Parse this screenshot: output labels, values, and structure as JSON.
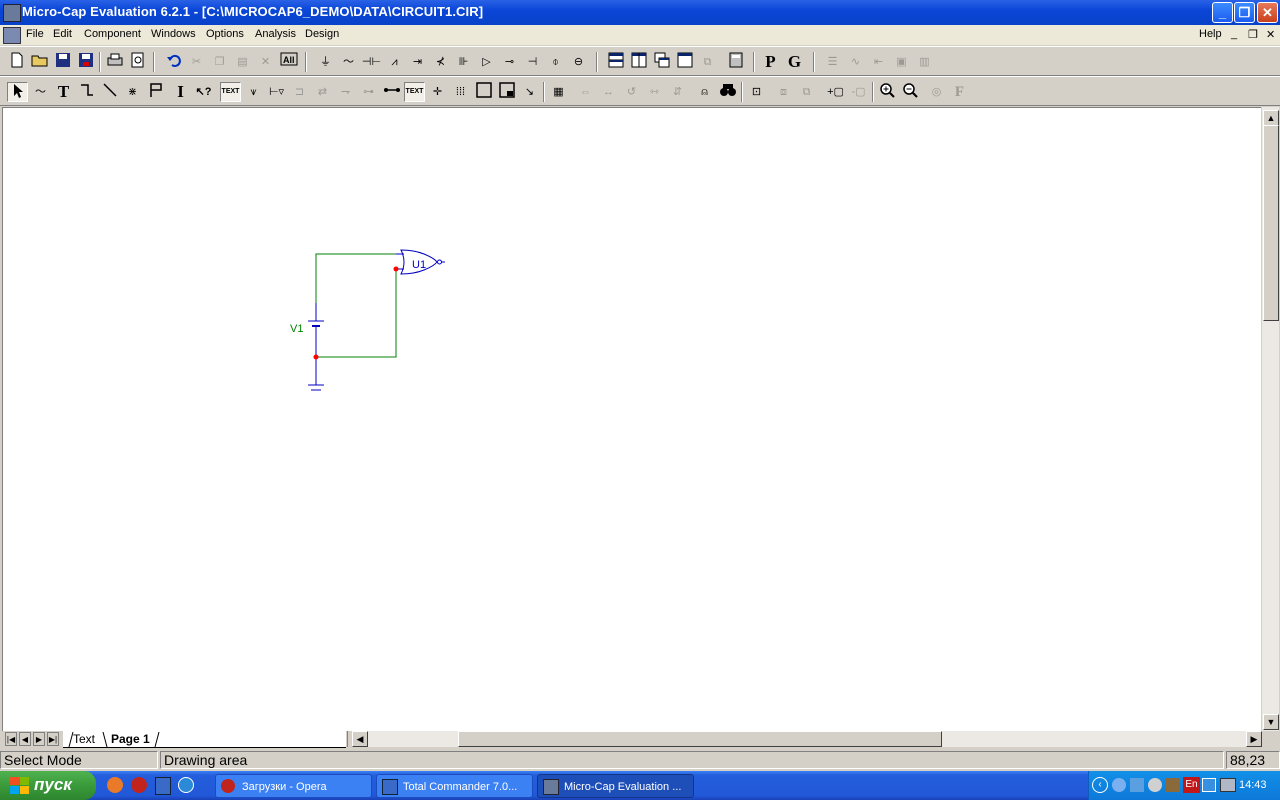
{
  "window": {
    "title": "Micro-Cap Evaluation 6.2.1 - [C:\\MICROCAP6_DEMO\\DATA\\CIRCUIT1.CIR]",
    "controls": {
      "minimize": "_",
      "restore": "❐",
      "close": "✕"
    }
  },
  "menubar": {
    "items": [
      "File",
      "Edit",
      "Component",
      "Windows",
      "Options",
      "Analysis",
      "Design"
    ],
    "help": "Help",
    "mdi_controls": {
      "minimize": "_",
      "restore": "❐",
      "close": "✕"
    }
  },
  "toolbar1": {
    "component_letters": {
      "p": "P",
      "g": "G"
    }
  },
  "toolbar2": {
    "text_button": "TEXT",
    "text_button2": "TEXT",
    "text_tool": "T",
    "info_tool": "I",
    "fourier": "F"
  },
  "schematic": {
    "battery_label": "V1",
    "gate_label": "U1",
    "wire_color": "#008000",
    "component_color": "#0000c0",
    "node_color": "#ff0000"
  },
  "tabs": {
    "items": [
      "Text",
      "Page 1"
    ],
    "active": "Page 1"
  },
  "statusbar": {
    "mode": "Select Mode",
    "hint": "Drawing area",
    "coords": "88,23"
  },
  "taskbar": {
    "start_label": "пуск",
    "tasks": [
      "Загрузки - Opera",
      "Total Commander 7.0...",
      "Micro-Cap Evaluation ..."
    ],
    "active_task": "Micro-Cap Evaluation ...",
    "tray": {
      "language": "En",
      "clock": "14:43"
    }
  }
}
